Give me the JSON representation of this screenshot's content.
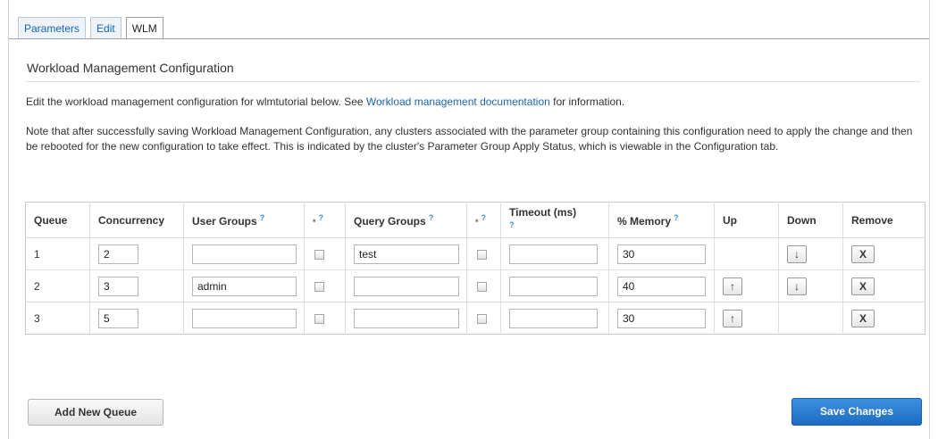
{
  "tabs": [
    {
      "label": "Parameters",
      "active": false
    },
    {
      "label": "Edit",
      "active": false
    },
    {
      "label": "WLM",
      "active": true
    }
  ],
  "section_title": "Workload Management Configuration",
  "intro": {
    "before": "Edit the workload management configuration for wlmtutorial below. See",
    "link": "Workload management documentation",
    "after": "for information."
  },
  "note": "Note that after successfully saving Workload Management Configuration, any clusters associated with the parameter group containing this configuration need to apply the change and then be rebooted for the new configuration to take effect. This is indicated by the cluster's Parameter Group Apply Status, which is viewable in the Configuration tab.",
  "table": {
    "headers": {
      "queue": "Queue",
      "concurrency": "Concurrency",
      "user_groups": "User Groups",
      "ug_wildcard": "*",
      "query_groups": "Query Groups",
      "qg_wildcard": "*",
      "timeout": "Timeout (ms)",
      "memory": "% Memory",
      "up": "Up",
      "down": "Down",
      "remove": "Remove"
    },
    "help_glyph": "?",
    "rows": [
      {
        "queue": "1",
        "concurrency": "2",
        "user_groups": "",
        "query_groups": "test",
        "timeout": "",
        "memory": "30"
      },
      {
        "queue": "2",
        "concurrency": "3",
        "user_groups": "admin",
        "query_groups": "",
        "timeout": "",
        "memory": "40"
      },
      {
        "queue": "3",
        "concurrency": "5",
        "user_groups": "",
        "query_groups": "",
        "timeout": "",
        "memory": "30"
      }
    ],
    "up_glyph": "↑",
    "down_glyph": "↓",
    "remove_glyph": "X"
  },
  "buttons": {
    "add_queue": "Add New Queue",
    "save": "Save Changes"
  },
  "colors": {
    "link": "#1a66b3",
    "primary_button": "#1d6cc4",
    "help_icon": "#3d8fd9"
  }
}
